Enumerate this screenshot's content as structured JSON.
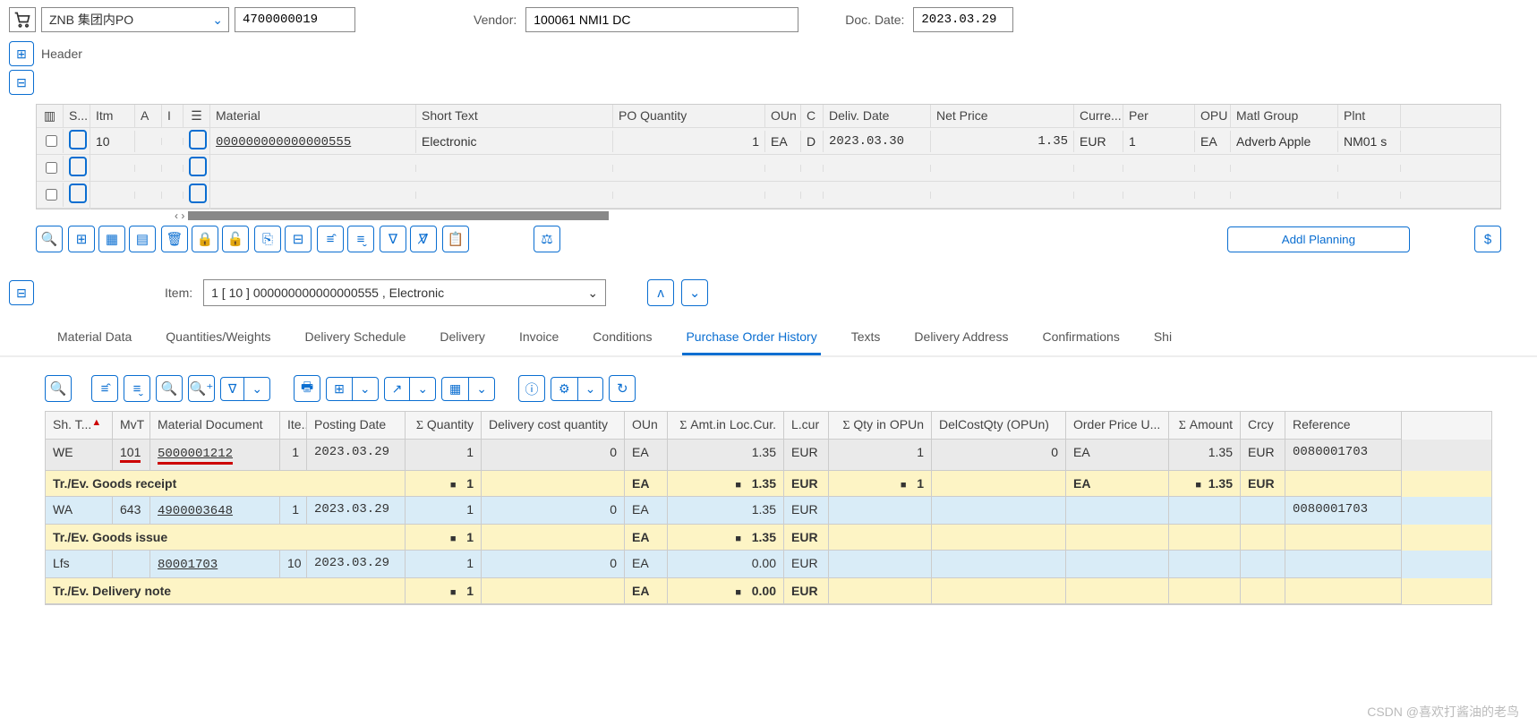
{
  "header": {
    "po_type": "ZNB 集团内PO",
    "po_number": "4700000019",
    "vendor_label": "Vendor:",
    "vendor": "100061 NMI1 DC",
    "doc_date_label": "Doc. Date:",
    "doc_date": "2023.03.29",
    "header_toggle": "Header"
  },
  "grid": {
    "cols": {
      "s": "S...",
      "itm": "Itm",
      "a": "A",
      "i": "I",
      "mat": "Material",
      "short": "Short Text",
      "poq": "PO Quantity",
      "oun": "OUn",
      "c": "C",
      "dd": "Deliv. Date",
      "np": "Net Price",
      "curr": "Curre...",
      "per": "Per",
      "opu": "OPU",
      "mg": "Matl Group",
      "plnt": "Plnt"
    },
    "rows": [
      {
        "itm": "10",
        "mat": "000000000000000555",
        "short": "Electronic",
        "poq": "1",
        "oun": "EA",
        "c": "D",
        "dd": "2023.03.30",
        "np": "1.35",
        "curr": "EUR",
        "per": "1",
        "opu": "EA",
        "mg": "Adverb Apple",
        "plnt": "NM01 s"
      }
    ]
  },
  "addl_planning": "Addl Planning",
  "item_area": {
    "label": "Item:",
    "value": "1 [ 10 ] 000000000000000555 , Electronic"
  },
  "tabs": [
    "Material Data",
    "Quantities/Weights",
    "Delivery Schedule",
    "Delivery",
    "Invoice",
    "Conditions",
    "Purchase Order History",
    "Texts",
    "Delivery Address",
    "Confirmations",
    "Shi"
  ],
  "active_tab": 6,
  "history": {
    "cols": {
      "sh": "Sh. T...",
      "mvt": "MvT",
      "mdoc": "Material Document",
      "ite": "Ite...",
      "pd": "Posting Date",
      "qty": "Quantity",
      "dcq": "Delivery cost quantity",
      "oun": "OUn",
      "alc": "Amt.in Loc.Cur.",
      "lcur": "L.cur",
      "qop": "Qty in OPUn",
      "dco": "DelCostQty (OPUn)",
      "opu": "Order Price U...",
      "amt": "Amount",
      "crcy": "Crcy",
      "ref": "Reference"
    },
    "rows": [
      {
        "type": "data",
        "bg": "grey",
        "sh": "WE",
        "mvt": "101",
        "mdoc": "5000001212",
        "ite": "1",
        "pd": "2023.03.29",
        "qty": "1",
        "dcq": "0",
        "oun": "EA",
        "alc": "1.35",
        "lcur": "EUR",
        "qop": "1",
        "dco": "0",
        "opu": "EA",
        "amt": "1.35",
        "crcy": "EUR",
        "ref": "0080001703",
        "red": true
      },
      {
        "type": "sum",
        "label": "Tr./Ev. Goods receipt",
        "qty": "1",
        "oun": "EA",
        "alc": "1.35",
        "lcur": "EUR",
        "qop": "1",
        "opu": "EA",
        "amt": "1.35",
        "crcy": "EUR"
      },
      {
        "type": "data",
        "bg": "blue",
        "sh": "WA",
        "mvt": "643",
        "mdoc": "4900003648",
        "ite": "1",
        "pd": "2023.03.29",
        "qty": "1",
        "dcq": "0",
        "oun": "EA",
        "alc": "1.35",
        "lcur": "EUR",
        "qop": "",
        "dco": "",
        "opu": "",
        "amt": "",
        "crcy": "",
        "ref": "0080001703"
      },
      {
        "type": "sum",
        "label": "Tr./Ev. Goods issue",
        "qty": "1",
        "oun": "EA",
        "alc": "1.35",
        "lcur": "EUR"
      },
      {
        "type": "data",
        "bg": "blue",
        "sh": "Lfs",
        "mvt": "",
        "mdoc": "80001703",
        "ite": "10",
        "pd": "2023.03.29",
        "qty": "1",
        "dcq": "0",
        "oun": "EA",
        "alc": "0.00",
        "lcur": "EUR",
        "qop": "",
        "dco": "",
        "opu": "",
        "amt": "",
        "crcy": "",
        "ref": ""
      },
      {
        "type": "sum",
        "label": "Tr./Ev. Delivery note",
        "qty": "1",
        "oun": "EA",
        "alc": "0.00",
        "lcur": "EUR"
      }
    ]
  },
  "watermark": "CSDN @喜欢打酱油的老鸟"
}
